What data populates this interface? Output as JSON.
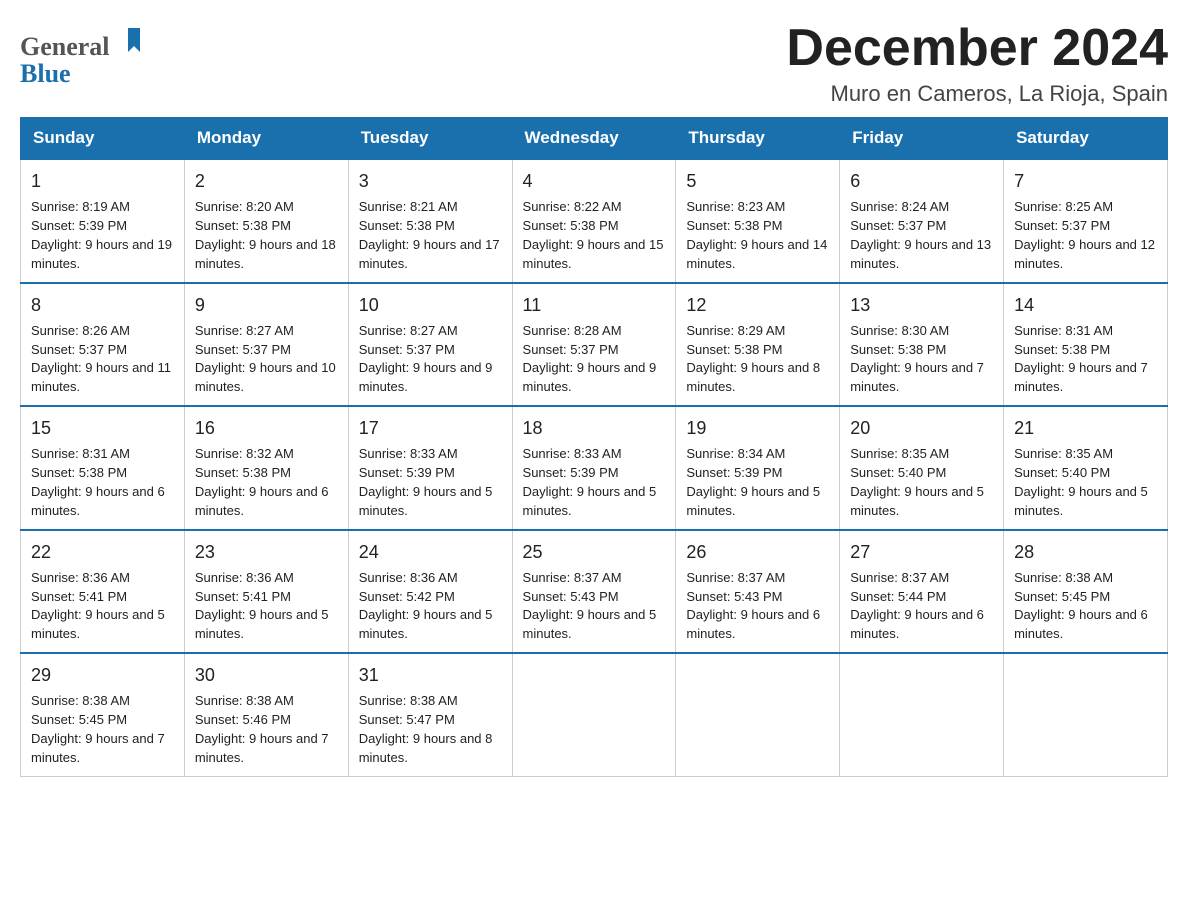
{
  "header": {
    "logo_general": "General",
    "logo_blue": "Blue",
    "main_title": "December 2024",
    "subtitle": "Muro en Cameros, La Rioja, Spain"
  },
  "calendar": {
    "days_of_week": [
      "Sunday",
      "Monday",
      "Tuesday",
      "Wednesday",
      "Thursday",
      "Friday",
      "Saturday"
    ],
    "weeks": [
      [
        {
          "day": "1",
          "sunrise": "Sunrise: 8:19 AM",
          "sunset": "Sunset: 5:39 PM",
          "daylight": "Daylight: 9 hours and 19 minutes."
        },
        {
          "day": "2",
          "sunrise": "Sunrise: 8:20 AM",
          "sunset": "Sunset: 5:38 PM",
          "daylight": "Daylight: 9 hours and 18 minutes."
        },
        {
          "day": "3",
          "sunrise": "Sunrise: 8:21 AM",
          "sunset": "Sunset: 5:38 PM",
          "daylight": "Daylight: 9 hours and 17 minutes."
        },
        {
          "day": "4",
          "sunrise": "Sunrise: 8:22 AM",
          "sunset": "Sunset: 5:38 PM",
          "daylight": "Daylight: 9 hours and 15 minutes."
        },
        {
          "day": "5",
          "sunrise": "Sunrise: 8:23 AM",
          "sunset": "Sunset: 5:38 PM",
          "daylight": "Daylight: 9 hours and 14 minutes."
        },
        {
          "day": "6",
          "sunrise": "Sunrise: 8:24 AM",
          "sunset": "Sunset: 5:37 PM",
          "daylight": "Daylight: 9 hours and 13 minutes."
        },
        {
          "day": "7",
          "sunrise": "Sunrise: 8:25 AM",
          "sunset": "Sunset: 5:37 PM",
          "daylight": "Daylight: 9 hours and 12 minutes."
        }
      ],
      [
        {
          "day": "8",
          "sunrise": "Sunrise: 8:26 AM",
          "sunset": "Sunset: 5:37 PM",
          "daylight": "Daylight: 9 hours and 11 minutes."
        },
        {
          "day": "9",
          "sunrise": "Sunrise: 8:27 AM",
          "sunset": "Sunset: 5:37 PM",
          "daylight": "Daylight: 9 hours and 10 minutes."
        },
        {
          "day": "10",
          "sunrise": "Sunrise: 8:27 AM",
          "sunset": "Sunset: 5:37 PM",
          "daylight": "Daylight: 9 hours and 9 minutes."
        },
        {
          "day": "11",
          "sunrise": "Sunrise: 8:28 AM",
          "sunset": "Sunset: 5:37 PM",
          "daylight": "Daylight: 9 hours and 9 minutes."
        },
        {
          "day": "12",
          "sunrise": "Sunrise: 8:29 AM",
          "sunset": "Sunset: 5:38 PM",
          "daylight": "Daylight: 9 hours and 8 minutes."
        },
        {
          "day": "13",
          "sunrise": "Sunrise: 8:30 AM",
          "sunset": "Sunset: 5:38 PM",
          "daylight": "Daylight: 9 hours and 7 minutes."
        },
        {
          "day": "14",
          "sunrise": "Sunrise: 8:31 AM",
          "sunset": "Sunset: 5:38 PM",
          "daylight": "Daylight: 9 hours and 7 minutes."
        }
      ],
      [
        {
          "day": "15",
          "sunrise": "Sunrise: 8:31 AM",
          "sunset": "Sunset: 5:38 PM",
          "daylight": "Daylight: 9 hours and 6 minutes."
        },
        {
          "day": "16",
          "sunrise": "Sunrise: 8:32 AM",
          "sunset": "Sunset: 5:38 PM",
          "daylight": "Daylight: 9 hours and 6 minutes."
        },
        {
          "day": "17",
          "sunrise": "Sunrise: 8:33 AM",
          "sunset": "Sunset: 5:39 PM",
          "daylight": "Daylight: 9 hours and 5 minutes."
        },
        {
          "day": "18",
          "sunrise": "Sunrise: 8:33 AM",
          "sunset": "Sunset: 5:39 PM",
          "daylight": "Daylight: 9 hours and 5 minutes."
        },
        {
          "day": "19",
          "sunrise": "Sunrise: 8:34 AM",
          "sunset": "Sunset: 5:39 PM",
          "daylight": "Daylight: 9 hours and 5 minutes."
        },
        {
          "day": "20",
          "sunrise": "Sunrise: 8:35 AM",
          "sunset": "Sunset: 5:40 PM",
          "daylight": "Daylight: 9 hours and 5 minutes."
        },
        {
          "day": "21",
          "sunrise": "Sunrise: 8:35 AM",
          "sunset": "Sunset: 5:40 PM",
          "daylight": "Daylight: 9 hours and 5 minutes."
        }
      ],
      [
        {
          "day": "22",
          "sunrise": "Sunrise: 8:36 AM",
          "sunset": "Sunset: 5:41 PM",
          "daylight": "Daylight: 9 hours and 5 minutes."
        },
        {
          "day": "23",
          "sunrise": "Sunrise: 8:36 AM",
          "sunset": "Sunset: 5:41 PM",
          "daylight": "Daylight: 9 hours and 5 minutes."
        },
        {
          "day": "24",
          "sunrise": "Sunrise: 8:36 AM",
          "sunset": "Sunset: 5:42 PM",
          "daylight": "Daylight: 9 hours and 5 minutes."
        },
        {
          "day": "25",
          "sunrise": "Sunrise: 8:37 AM",
          "sunset": "Sunset: 5:43 PM",
          "daylight": "Daylight: 9 hours and 5 minutes."
        },
        {
          "day": "26",
          "sunrise": "Sunrise: 8:37 AM",
          "sunset": "Sunset: 5:43 PM",
          "daylight": "Daylight: 9 hours and 6 minutes."
        },
        {
          "day": "27",
          "sunrise": "Sunrise: 8:37 AM",
          "sunset": "Sunset: 5:44 PM",
          "daylight": "Daylight: 9 hours and 6 minutes."
        },
        {
          "day": "28",
          "sunrise": "Sunrise: 8:38 AM",
          "sunset": "Sunset: 5:45 PM",
          "daylight": "Daylight: 9 hours and 6 minutes."
        }
      ],
      [
        {
          "day": "29",
          "sunrise": "Sunrise: 8:38 AM",
          "sunset": "Sunset: 5:45 PM",
          "daylight": "Daylight: 9 hours and 7 minutes."
        },
        {
          "day": "30",
          "sunrise": "Sunrise: 8:38 AM",
          "sunset": "Sunset: 5:46 PM",
          "daylight": "Daylight: 9 hours and 7 minutes."
        },
        {
          "day": "31",
          "sunrise": "Sunrise: 8:38 AM",
          "sunset": "Sunset: 5:47 PM",
          "daylight": "Daylight: 9 hours and 8 minutes."
        },
        null,
        null,
        null,
        null
      ]
    ]
  }
}
